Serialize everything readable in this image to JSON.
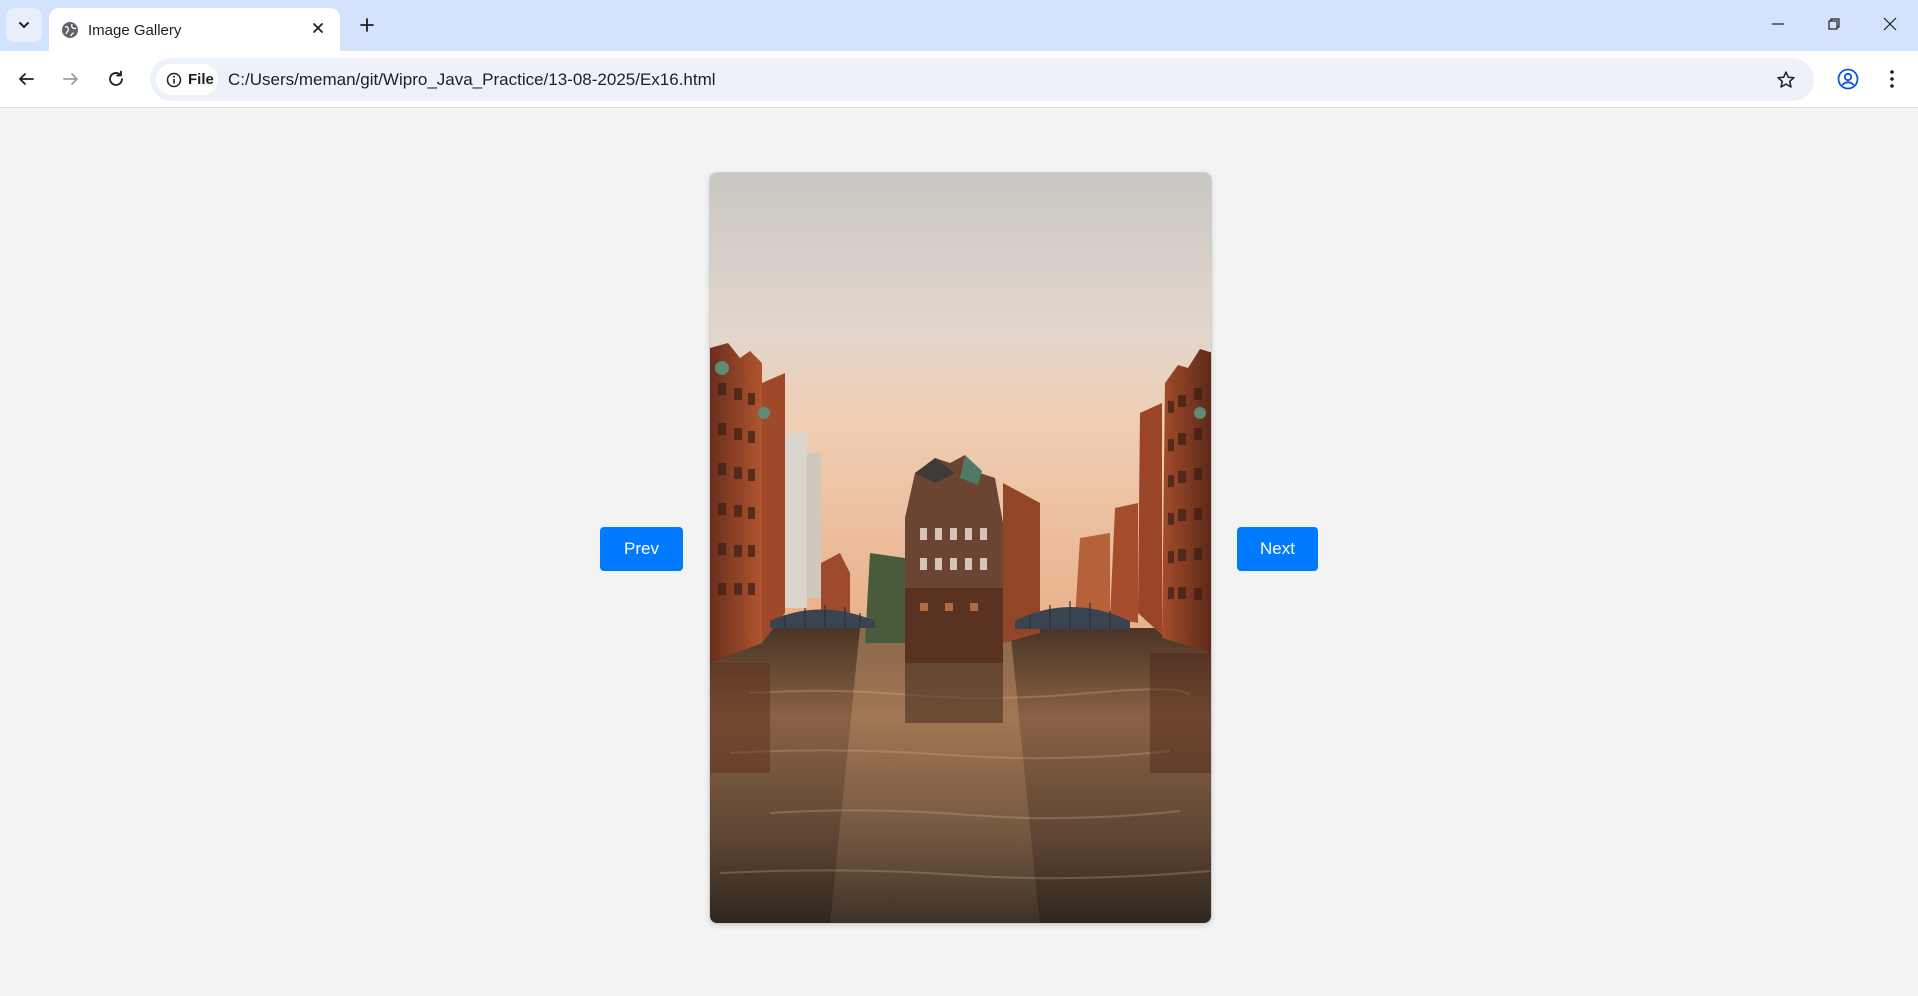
{
  "browser": {
    "tab_title": "Image Gallery",
    "site_chip_label": "File",
    "url": "C:/Users/meman/git/Wipro_Java_Practice/13-08-2025/Ex16.html"
  },
  "gallery": {
    "prev_label": "Prev",
    "next_label": "Next"
  },
  "colors": {
    "accent": "#007bff",
    "page_background": "#f3f3f3",
    "tabstrip": "#d3e3fd"
  }
}
